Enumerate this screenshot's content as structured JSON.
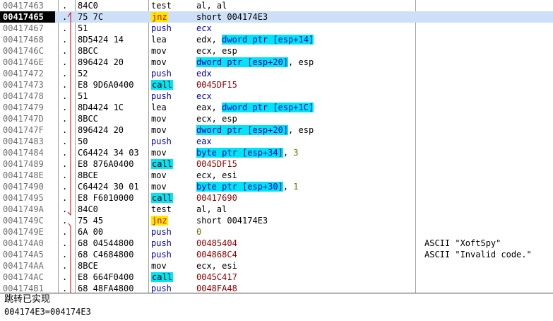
{
  "rows": [
    {
      "addr": "00417463",
      "flag": ".",
      "hex": "84C0",
      "mn": "test",
      "parts": [
        {
          "t": "al, al"
        }
      ],
      "cmt": ""
    },
    {
      "addr": "00417465",
      "flag": ".",
      "hex": "75 7C",
      "mn": "jnz",
      "parts": [
        {
          "t": "short 004174E3"
        }
      ],
      "cmt": "",
      "selected": true,
      "current": true
    },
    {
      "addr": "00417467",
      "flag": ".",
      "hex": "51",
      "mn": "push",
      "parts": [
        {
          "t": "ecx"
        }
      ],
      "cmt": ""
    },
    {
      "addr": "00417468",
      "flag": ".",
      "hex": "8D5424 14",
      "mn": "lea",
      "parts": [
        {
          "t": "edx, "
        },
        {
          "t": "dword ptr [esp+14]",
          "k": "mem"
        }
      ],
      "cmt": ""
    },
    {
      "addr": "0041746C",
      "flag": ".",
      "hex": "8BCC",
      "mn": "mov",
      "parts": [
        {
          "t": "ecx, esp"
        }
      ],
      "cmt": ""
    },
    {
      "addr": "0041746E",
      "flag": ".",
      "hex": "896424 20",
      "mn": "mov",
      "parts": [
        {
          "t": "dword ptr [esp+20]",
          "k": "mem"
        },
        {
          "t": ", esp"
        }
      ],
      "cmt": ""
    },
    {
      "addr": "00417472",
      "flag": ".",
      "hex": "52",
      "mn": "push",
      "parts": [
        {
          "t": "edx"
        }
      ],
      "cmt": ""
    },
    {
      "addr": "00417473",
      "flag": ".",
      "hex": "E8 9D6A0400",
      "mn": "call",
      "parts": [
        {
          "t": "0045DF15",
          "k": "addr"
        }
      ],
      "cmt": ""
    },
    {
      "addr": "00417478",
      "flag": ".",
      "hex": "51",
      "mn": "push",
      "parts": [
        {
          "t": "ecx"
        }
      ],
      "cmt": ""
    },
    {
      "addr": "00417479",
      "flag": ".",
      "hex": "8D4424 1C",
      "mn": "lea",
      "parts": [
        {
          "t": "eax, "
        },
        {
          "t": "dword ptr [esp+1C]",
          "k": "mem"
        }
      ],
      "cmt": ""
    },
    {
      "addr": "0041747D",
      "flag": ".",
      "hex": "8BCC",
      "mn": "mov",
      "parts": [
        {
          "t": "ecx, esp"
        }
      ],
      "cmt": ""
    },
    {
      "addr": "0041747F",
      "flag": ".",
      "hex": "896424 20",
      "mn": "mov",
      "parts": [
        {
          "t": "dword ptr [esp+20]",
          "k": "mem"
        },
        {
          "t": ", esp"
        }
      ],
      "cmt": ""
    },
    {
      "addr": "00417483",
      "flag": ".",
      "hex": "50",
      "mn": "push",
      "parts": [
        {
          "t": "eax"
        }
      ],
      "cmt": ""
    },
    {
      "addr": "00417484",
      "flag": ".",
      "hex": "C64424 34 03",
      "mn": "mov",
      "parts": [
        {
          "t": "byte ptr [esp+34]",
          "k": "mem"
        },
        {
          "t": ", "
        },
        {
          "t": "3",
          "k": "num"
        }
      ],
      "cmt": ""
    },
    {
      "addr": "00417489",
      "flag": ".",
      "hex": "E8 876A0400",
      "mn": "call",
      "parts": [
        {
          "t": "0045DF15",
          "k": "addr"
        }
      ],
      "cmt": ""
    },
    {
      "addr": "0041748E",
      "flag": ".",
      "hex": "8BCE",
      "mn": "mov",
      "parts": [
        {
          "t": "ecx, esi"
        }
      ],
      "cmt": ""
    },
    {
      "addr": "00417490",
      "flag": ".",
      "hex": "C64424 30 01",
      "mn": "mov",
      "parts": [
        {
          "t": "byte ptr [esp+30]",
          "k": "mem"
        },
        {
          "t": ", "
        },
        {
          "t": "1",
          "k": "num"
        }
      ],
      "cmt": ""
    },
    {
      "addr": "00417495",
      "flag": ".",
      "hex": "E8 F6010000",
      "mn": "call",
      "parts": [
        {
          "t": "00417690",
          "k": "addr"
        }
      ],
      "cmt": ""
    },
    {
      "addr": "0041749A",
      "flag": ".",
      "hex": "84C0",
      "mn": "test",
      "parts": [
        {
          "t": "al, al"
        }
      ],
      "cmt": ""
    },
    {
      "addr": "0041749C",
      "flag": ".",
      "hex": "75 45",
      "mn": "jnz",
      "parts": [
        {
          "t": "short 004174E3"
        }
      ],
      "cmt": ""
    },
    {
      "addr": "0041749E",
      "flag": ".",
      "hex": "6A 00",
      "mn": "push",
      "parts": [
        {
          "t": "0",
          "k": "num"
        }
      ],
      "cmt": ""
    },
    {
      "addr": "004174A0",
      "flag": ".",
      "hex": "68 04544800",
      "mn": "push",
      "parts": [
        {
          "t": "00485404",
          "k": "addr"
        }
      ],
      "cmt": "ASCII \"XoftSpy\""
    },
    {
      "addr": "004174A5",
      "flag": ".",
      "hex": "68 C4684800",
      "mn": "push",
      "parts": [
        {
          "t": "004868C4",
          "k": "addr"
        }
      ],
      "cmt": "ASCII \"Invalid code.\""
    },
    {
      "addr": "004174AA",
      "flag": ".",
      "hex": "8BCE",
      "mn": "mov",
      "parts": [
        {
          "t": "ecx, esi"
        }
      ],
      "cmt": ""
    },
    {
      "addr": "004174AC",
      "flag": ".",
      "hex": "E8 664F0400",
      "mn": "call",
      "parts": [
        {
          "t": "0045C417",
          "k": "addr"
        }
      ],
      "cmt": ""
    },
    {
      "addr": "004174B1",
      "flag": ".",
      "hex": "68 48FA4800",
      "mn": "push",
      "parts": [
        {
          "t": "0048FA48",
          "k": "addr"
        }
      ],
      "cmt": ""
    }
  ],
  "info": {
    "line1": "跳转已实现",
    "line2": "004174E3=004174E3"
  },
  "colors": {
    "selected_row": "#cde0f7",
    "call_highlight": "#00e5f5",
    "jump_highlight": "#ffe800",
    "jump_text": "#d00000",
    "push_text": "#0000b0",
    "address_operand": "#8b0000",
    "constant": "#707000",
    "jump_arrow": "#d00000"
  }
}
